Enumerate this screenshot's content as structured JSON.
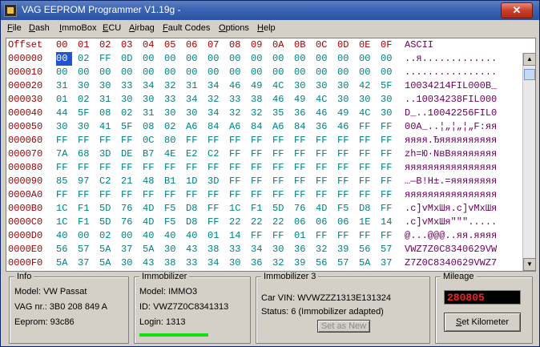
{
  "window": {
    "title": "VAG EEPROM Programmer  V1.19g -"
  },
  "menu": [
    {
      "id": "file",
      "label": "File",
      "u": "F",
      "rest": "ile"
    },
    {
      "id": "dash",
      "label": "Dash",
      "u": "D",
      "rest": "ash"
    },
    {
      "id": "immobox",
      "label": "ImmoBox",
      "u": "I",
      "rest": "mmoBox"
    },
    {
      "id": "ecu",
      "label": "ECU",
      "u": "E",
      "rest": "CU"
    },
    {
      "id": "airbag",
      "label": "Airbag",
      "u": "A",
      "rest": "irbag"
    },
    {
      "id": "fault",
      "label": "Fault Codes",
      "u": "F",
      "rest": "ault Codes"
    },
    {
      "id": "options",
      "label": "Options",
      "u": "O",
      "rest": "ptions"
    },
    {
      "id": "help",
      "label": "Help",
      "u": "H",
      "rest": "elp"
    }
  ],
  "hex": {
    "header_offset": "Offset",
    "header_cols": [
      "00",
      "01",
      "02",
      "03",
      "04",
      "05",
      "06",
      "07",
      "08",
      "09",
      "0A",
      "0B",
      "0C",
      "0D",
      "0E",
      "0F"
    ],
    "header_ascii": "ASCII",
    "rows": [
      {
        "offset": "000000",
        "bytes": [
          "00",
          "02",
          "FF",
          "0D",
          "00",
          "00",
          "00",
          "00",
          "00",
          "00",
          "00",
          "00",
          "00",
          "00",
          "00",
          "00"
        ],
        "ascii": "..я............."
      },
      {
        "offset": "000010",
        "bytes": [
          "00",
          "00",
          "00",
          "00",
          "00",
          "00",
          "00",
          "00",
          "00",
          "00",
          "00",
          "00",
          "00",
          "00",
          "00",
          "00"
        ],
        "ascii": "................"
      },
      {
        "offset": "000020",
        "bytes": [
          "31",
          "30",
          "30",
          "33",
          "34",
          "32",
          "31",
          "34",
          "46",
          "49",
          "4C",
          "30",
          "30",
          "30",
          "42",
          "5F"
        ],
        "ascii": "10034214FIL000B_"
      },
      {
        "offset": "000030",
        "bytes": [
          "01",
          "02",
          "31",
          "30",
          "30",
          "33",
          "34",
          "32",
          "33",
          "38",
          "46",
          "49",
          "4C",
          "30",
          "30",
          "30"
        ],
        "ascii": "..10034238FIL000"
      },
      {
        "offset": "000040",
        "bytes": [
          "44",
          "5F",
          "08",
          "02",
          "31",
          "30",
          "30",
          "34",
          "32",
          "32",
          "35",
          "36",
          "46",
          "49",
          "4C",
          "30"
        ],
        "ascii": "D_..10042256FIL0"
      },
      {
        "offset": "000050",
        "bytes": [
          "30",
          "30",
          "41",
          "5F",
          "08",
          "02",
          "A6",
          "84",
          "A6",
          "84",
          "A6",
          "84",
          "36",
          "46",
          "FF",
          "FF"
        ],
        "ascii": "00A_..¦„¦„¦„F:яя"
      },
      {
        "offset": "000060",
        "bytes": [
          "FF",
          "FF",
          "FF",
          "FF",
          "0C",
          "80",
          "FF",
          "FF",
          "FF",
          "FF",
          "FF",
          "FF",
          "FF",
          "FF",
          "FF",
          "FF"
        ],
        "ascii": "яяяя.Ђяяяяяяяяяя"
      },
      {
        "offset": "000070",
        "bytes": [
          "7A",
          "68",
          "3D",
          "DE",
          "B7",
          "4E",
          "E2",
          "C2",
          "FF",
          "FF",
          "FF",
          "FF",
          "FF",
          "FF",
          "FF",
          "FF"
        ],
        "ascii": "zh=Ю·NвВяяяяяяяя"
      },
      {
        "offset": "000080",
        "bytes": [
          "FF",
          "FF",
          "FF",
          "FF",
          "FF",
          "FF",
          "FF",
          "FF",
          "FF",
          "FF",
          "FF",
          "FF",
          "FF",
          "FF",
          "FF",
          "FF"
        ],
        "ascii": "яяяяяяяяяяяяяяяя"
      },
      {
        "offset": "000090",
        "bytes": [
          "85",
          "97",
          "C2",
          "21",
          "48",
          "B1",
          "1D",
          "3D",
          "FF",
          "FF",
          "FF",
          "FF",
          "FF",
          "FF",
          "FF",
          "FF"
        ],
        "ascii": "…—В!H±.=яяяяяяяя"
      },
      {
        "offset": "0000A0",
        "bytes": [
          "FF",
          "FF",
          "FF",
          "FF",
          "FF",
          "FF",
          "FF",
          "FF",
          "FF",
          "FF",
          "FF",
          "FF",
          "FF",
          "FF",
          "FF",
          "FF"
        ],
        "ascii": "яяяяяяяяяяяяяяяя"
      },
      {
        "offset": "0000B0",
        "bytes": [
          "1C",
          "F1",
          "5D",
          "76",
          "4D",
          "F5",
          "D8",
          "FF",
          "1C",
          "F1",
          "5D",
          "76",
          "4D",
          "F5",
          "D8",
          "FF"
        ],
        "ascii": ".c]vMxШя.c]vMxШя"
      },
      {
        "offset": "0000C0",
        "bytes": [
          "1C",
          "F1",
          "5D",
          "76",
          "4D",
          "F5",
          "D8",
          "FF",
          "22",
          "22",
          "22",
          "06",
          "06",
          "06",
          "1E",
          "14"
        ],
        "ascii": ".c]vMxШя\"\"\"....."
      },
      {
        "offset": "0000D0",
        "bytes": [
          "40",
          "00",
          "02",
          "00",
          "40",
          "40",
          "40",
          "01",
          "14",
          "FF",
          "FF",
          "01",
          "FF",
          "FF",
          "FF",
          "FF"
        ],
        "ascii": "@...@@@..яя.яяяя"
      },
      {
        "offset": "0000E0",
        "bytes": [
          "56",
          "57",
          "5A",
          "37",
          "5A",
          "30",
          "43",
          "38",
          "33",
          "34",
          "30",
          "36",
          "32",
          "39",
          "56",
          "57"
        ],
        "ascii": "VWZ7Z0C8340629VW"
      },
      {
        "offset": "0000F0",
        "bytes": [
          "5A",
          "37",
          "5A",
          "30",
          "43",
          "38",
          "33",
          "34",
          "30",
          "36",
          "32",
          "39",
          "56",
          "57",
          "5A",
          "37"
        ],
        "ascii": "Z7Z0C8340629VWZ7"
      }
    ]
  },
  "info": {
    "legend": "Info",
    "model": "Model:  VW Passat",
    "vag_nr": "VAG nr.: 3B0 208 849 A",
    "eeprom": "Eeprom: 93c86"
  },
  "immobilizer": {
    "legend": "Immobilizer",
    "model": "Model:  IMMO3",
    "id": "ID: VWZ7Z0C8341313",
    "login": "Login: 1313"
  },
  "immobilizer3": {
    "legend": "Immobilizer 3",
    "vin": "Car VIN:  WVWZZZ1313E131324",
    "status": "Status: 6 (Immobilizer adapted)",
    "set_as_new": "Set as New"
  },
  "mileage": {
    "legend": "Mileage",
    "value": "280805",
    "set_km_u": "S",
    "set_km_rest": "et Kilometer"
  },
  "colors": {
    "offset": "#a00000",
    "hex": "#008080",
    "ascii": "#6a005a",
    "login_ok": "#10e010",
    "mileage_text": "#ff2020"
  }
}
